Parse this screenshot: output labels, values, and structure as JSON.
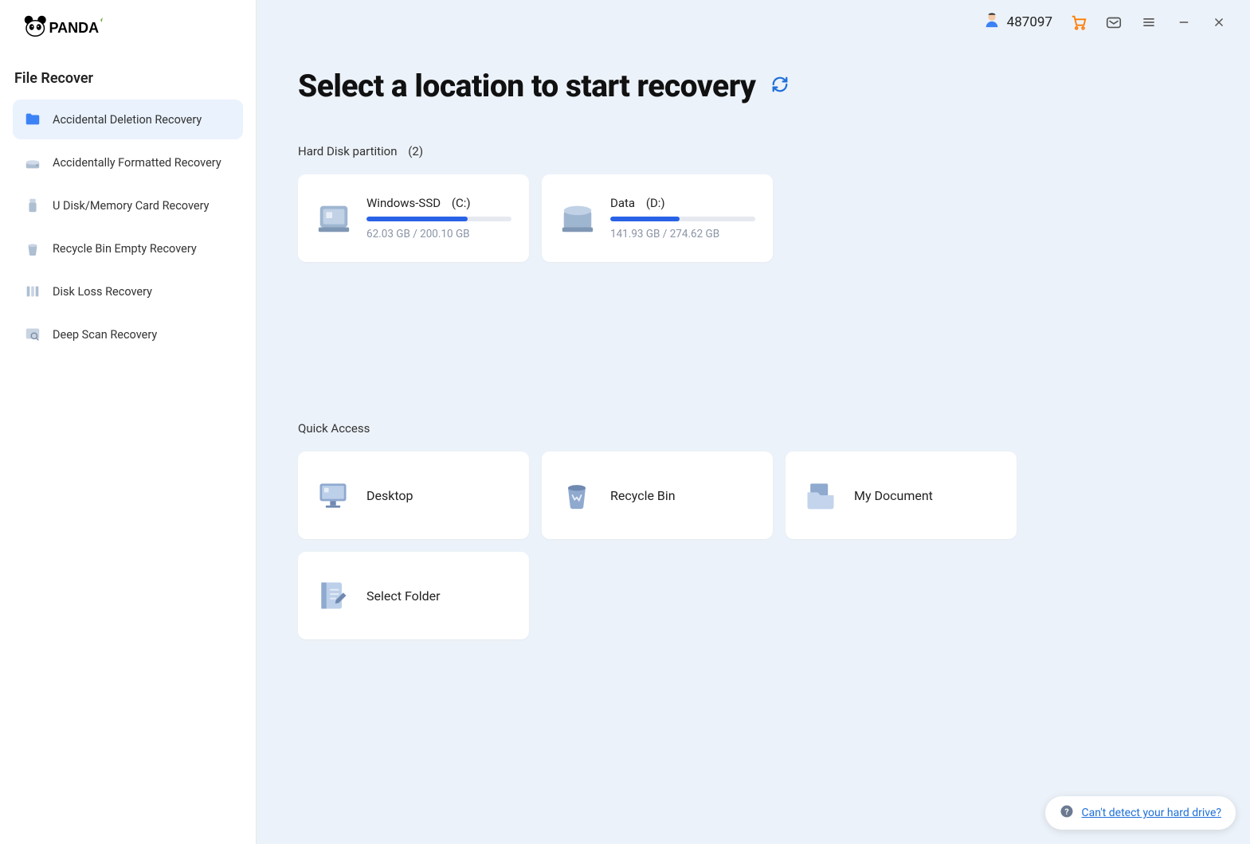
{
  "brand": "PANDA",
  "sidebar": {
    "title": "File Recover",
    "items": [
      {
        "label": "Accidental Deletion Recovery",
        "active": true
      },
      {
        "label": "Accidentally Formatted Recovery",
        "active": false
      },
      {
        "label": "U Disk/Memory Card Recovery",
        "active": false
      },
      {
        "label": "Recycle Bin Empty Recovery",
        "active": false
      },
      {
        "label": "Disk Loss Recovery",
        "active": false
      },
      {
        "label": "Deep Scan Recovery",
        "active": false
      }
    ]
  },
  "header": {
    "user_id": "487097"
  },
  "main": {
    "title": "Select a location to start recovery",
    "disk_section": {
      "label": "Hard Disk partition",
      "count": "(2)",
      "disks": [
        {
          "name": "Windows-SSD",
          "letter": "(C:)",
          "used": "62.03 GB",
          "total": "200.10 GB",
          "usage_text": "62.03 GB / 200.10 GB",
          "percent": 70
        },
        {
          "name": "Data",
          "letter": "(D:)",
          "used": "141.93 GB",
          "total": "274.62 GB",
          "usage_text": "141.93 GB / 274.62 GB",
          "percent": 48
        }
      ]
    },
    "quick_section": {
      "label": "Quick Access",
      "items": [
        {
          "label": "Desktop"
        },
        {
          "label": "Recycle Bin"
        },
        {
          "label": "My Document"
        },
        {
          "label": "Select Folder"
        }
      ]
    }
  },
  "help": {
    "link_text": "Can't detect your hard drive?"
  }
}
